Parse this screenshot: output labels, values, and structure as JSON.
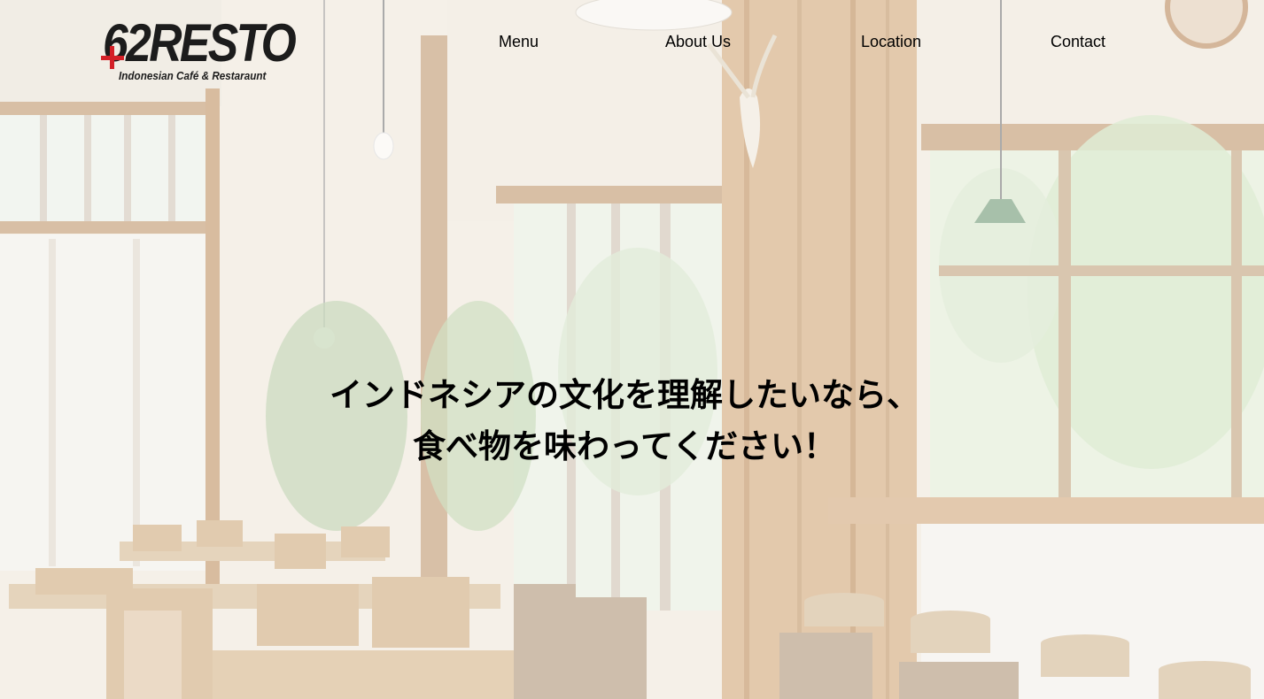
{
  "brand": {
    "logo_main": "62RESTO",
    "logo_sub": "Indonesian Café & Restaraunt",
    "accent_color": "#d42027"
  },
  "nav": {
    "items": [
      {
        "label": "Menu"
      },
      {
        "label": "About Us"
      },
      {
        "label": "Location"
      },
      {
        "label": "Contact"
      }
    ]
  },
  "hero": {
    "line1": "インドネシアの文化を理解したいなら、",
    "line2": "食べ物を味わってください！"
  }
}
